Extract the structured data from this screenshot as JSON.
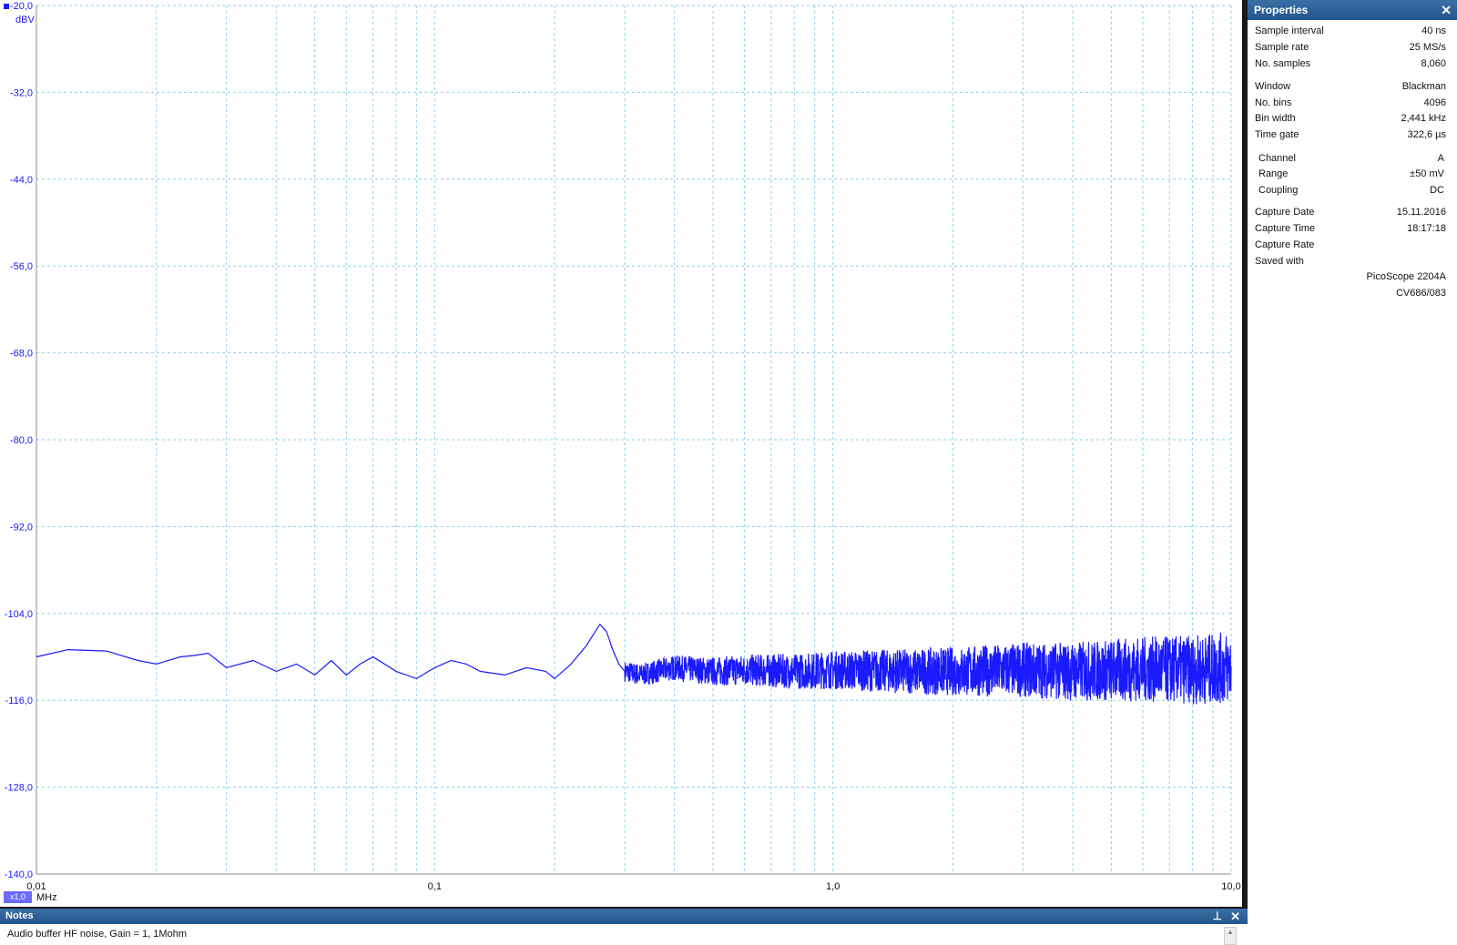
{
  "plot": {
    "y_unit": "dBV",
    "x_unit": "MHz",
    "scale_badge": "x1,0",
    "y_ticks": [
      "-20,0",
      "-32,0",
      "-44,0",
      "-56,0",
      "-68,0",
      "-80,0",
      "-92,0",
      "-104,0",
      "-116,0",
      "-128,0",
      "-140,0"
    ],
    "x_ticks": [
      "0,01",
      "0,1",
      "1,0",
      "10,0"
    ],
    "trace_color": "#1a1aff",
    "grid_color": "#8fd0e8"
  },
  "chart_data": {
    "type": "line",
    "title": "",
    "xlabel": "MHz",
    "ylabel": "dBV",
    "x_scale": "log",
    "xlim": [
      0.01,
      10.0
    ],
    "ylim": [
      -140,
      -20
    ],
    "grid": true,
    "series": [
      {
        "x": [
          0.01,
          0.012,
          0.015,
          0.018,
          0.02,
          0.023,
          0.025,
          0.027,
          0.03,
          0.035,
          0.04,
          0.045,
          0.05,
          0.055,
          0.06,
          0.065,
          0.07,
          0.08,
          0.09,
          0.1,
          0.11,
          0.12,
          0.13,
          0.15,
          0.17,
          0.19,
          0.2,
          0.22,
          0.24,
          0.26,
          0.27,
          0.28,
          0.29,
          0.3,
          0.33,
          0.36,
          0.4,
          0.5,
          0.6,
          0.8,
          1.0,
          1.5,
          2.0,
          3.0,
          4.0,
          6.0,
          8.0,
          10.0
        ],
        "y": [
          -110.0,
          -109.0,
          -109.2,
          -110.5,
          -111.0,
          -110.0,
          -109.8,
          -109.5,
          -111.5,
          -110.5,
          -112.0,
          -111.0,
          -112.5,
          -110.5,
          -112.5,
          -111.0,
          -110.0,
          -112.0,
          -113.0,
          -111.5,
          -110.5,
          -111.0,
          -112.0,
          -112.5,
          -111.5,
          -112.0,
          -113.0,
          -111.0,
          -108.5,
          -105.5,
          -106.5,
          -109.0,
          -111.0,
          -112.0,
          -112.5,
          -112.0,
          -111.5,
          -112.0,
          -111.8,
          -112.0,
          -111.8,
          -112.0,
          -112.0,
          -111.8,
          -112.0,
          -111.7,
          -111.8,
          -111.5
        ]
      }
    ]
  },
  "properties": {
    "title": "Properties",
    "rows": [
      {
        "k": "Sample interval",
        "v": "40 ns"
      },
      {
        "k": "Sample rate",
        "v": "25 MS/s"
      },
      {
        "k": "No. samples",
        "v": "8,060"
      },
      {
        "k": "Window",
        "v": "Blackman"
      },
      {
        "k": "No. bins",
        "v": "4096"
      },
      {
        "k": "Bin width",
        "v": "2,441 kHz"
      },
      {
        "k": "Time gate",
        "v": "322,6 µs"
      },
      {
        "k": "Channel",
        "v": "A"
      },
      {
        "k": "Range",
        "v": "±50 mV"
      },
      {
        "k": "Coupling",
        "v": "DC"
      },
      {
        "k": "Capture Date",
        "v": "15.11.2016"
      },
      {
        "k": "Capture Time",
        "v": "18:17:18"
      },
      {
        "k": "Capture Rate",
        "v": ""
      },
      {
        "k": "Saved with",
        "v": ""
      },
      {
        "k": "",
        "v": "PicoScope 2204A"
      },
      {
        "k": "",
        "v": "CV686/083"
      }
    ]
  },
  "notes": {
    "title": "Notes",
    "text": "Audio buffer HF noise, Gain = 1, 1Mohm"
  },
  "icons": {
    "close": "close-icon",
    "pin": "pin-icon"
  }
}
